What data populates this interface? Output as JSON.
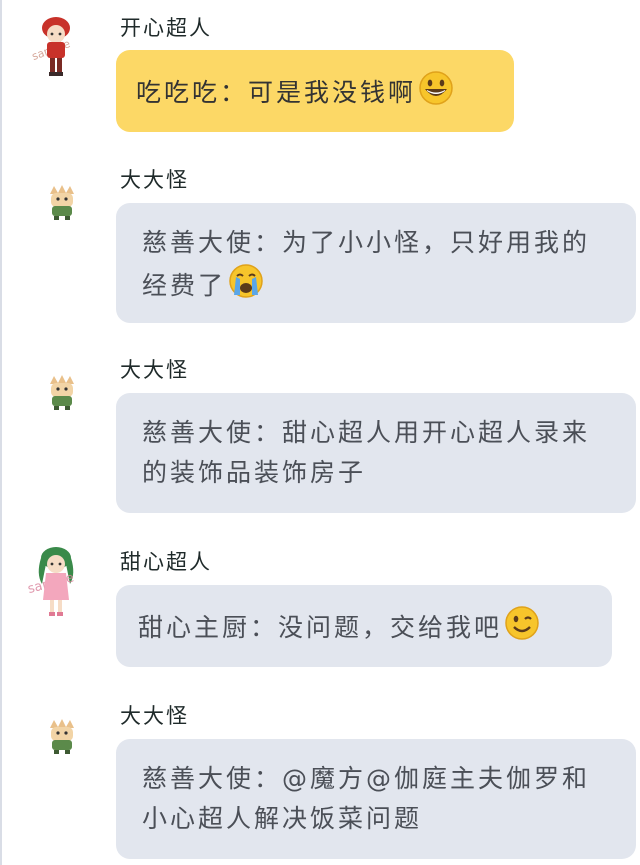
{
  "messages": [
    {
      "sender": "开心超人",
      "text": "吃吃吃：可是我没钱啊",
      "emoji": "grinning-face-emoji",
      "avatar": "red-hair-chibi-avatar",
      "avatar_watermark": "sample",
      "bubble_color": "#fcd866"
    },
    {
      "sender": "大大怪",
      "text": "慈善大使：为了小小怪，只好用我的经费了",
      "emoji": "crying-face-emoji",
      "avatar": "monster-chibi-avatar",
      "bubble_color": "#e2e6ee"
    },
    {
      "sender": "大大怪",
      "text": "慈善大使：甜心超人用开心超人录来的装饰品装饰房子",
      "avatar": "monster-chibi-avatar",
      "bubble_color": "#e2e6ee"
    },
    {
      "sender": "甜心超人",
      "text": "甜心主厨：没问题，交给我吧",
      "emoji": "winking-face-emoji",
      "avatar": "green-hair-chibi-avatar",
      "avatar_watermark": "sample",
      "bubble_color": "#e2e6ee"
    },
    {
      "sender": "大大怪",
      "text": "慈善大使：@魔方@伽庭主夫伽罗和小心超人解决饭菜问题",
      "avatar": "monster-chibi-avatar",
      "bubble_color": "#e2e6ee"
    }
  ]
}
